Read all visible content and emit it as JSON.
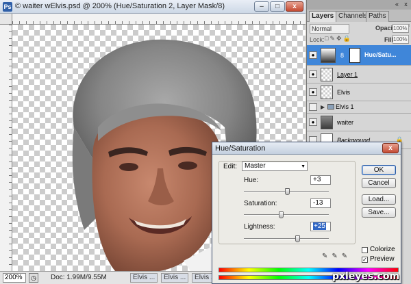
{
  "document": {
    "title": "© waiter wElvis.psd @ 200% (Hue/Saturation 2, Layer Mask/8)",
    "title_icon": "Ps",
    "win_min": "–",
    "win_max": "□",
    "win_close": "x",
    "zoom": "200%",
    "doc_size": "Doc: 1.99M/9.55M",
    "taskbar_tabs": [
      "Elvis ...",
      "Elvis ...",
      "Elvis ..."
    ]
  },
  "layers_panel": {
    "tabs": [
      "Layers",
      "Channels",
      "Paths"
    ],
    "active_tab": "Layers",
    "blend_mode": "Normal",
    "opacity_label": "Opacity:",
    "opacity_value": "100%",
    "lock_label": "Lock:",
    "fill_label": "Fill:",
    "fill_value": "100%",
    "layers": [
      {
        "name": "Hue/Satu...",
        "kind": "adjustment",
        "selected": true
      },
      {
        "name": "Layer 1",
        "kind": "pixel"
      },
      {
        "name": "Elvis",
        "kind": "pixel"
      },
      {
        "name": "Elvis 1",
        "kind": "group"
      },
      {
        "name": "waiter",
        "kind": "image"
      },
      {
        "name": "Background",
        "kind": "background",
        "locked": true
      }
    ]
  },
  "hue_saturation": {
    "title": "Hue/Saturation",
    "edit_label": "Edit:",
    "edit_value": "Master",
    "hue_label": "Hue:",
    "hue_value": "+3",
    "saturation_label": "Saturation:",
    "saturation_value": "-13",
    "lightness_label": "Lightness:",
    "lightness_value": "+25",
    "hue_level": 0.508,
    "saturation_level": 0.435,
    "lightness_level": 0.625,
    "buttons": {
      "ok": "OK",
      "cancel": "Cancel",
      "load": "Load...",
      "save": "Save..."
    },
    "colorize_label": "Colorize",
    "colorize_checked": false,
    "preview_label": "Preview",
    "preview_checked": true
  },
  "watermark": "pxleyes.com",
  "colors": {
    "selection": "#3f86d9",
    "accent": "#3167c5"
  }
}
